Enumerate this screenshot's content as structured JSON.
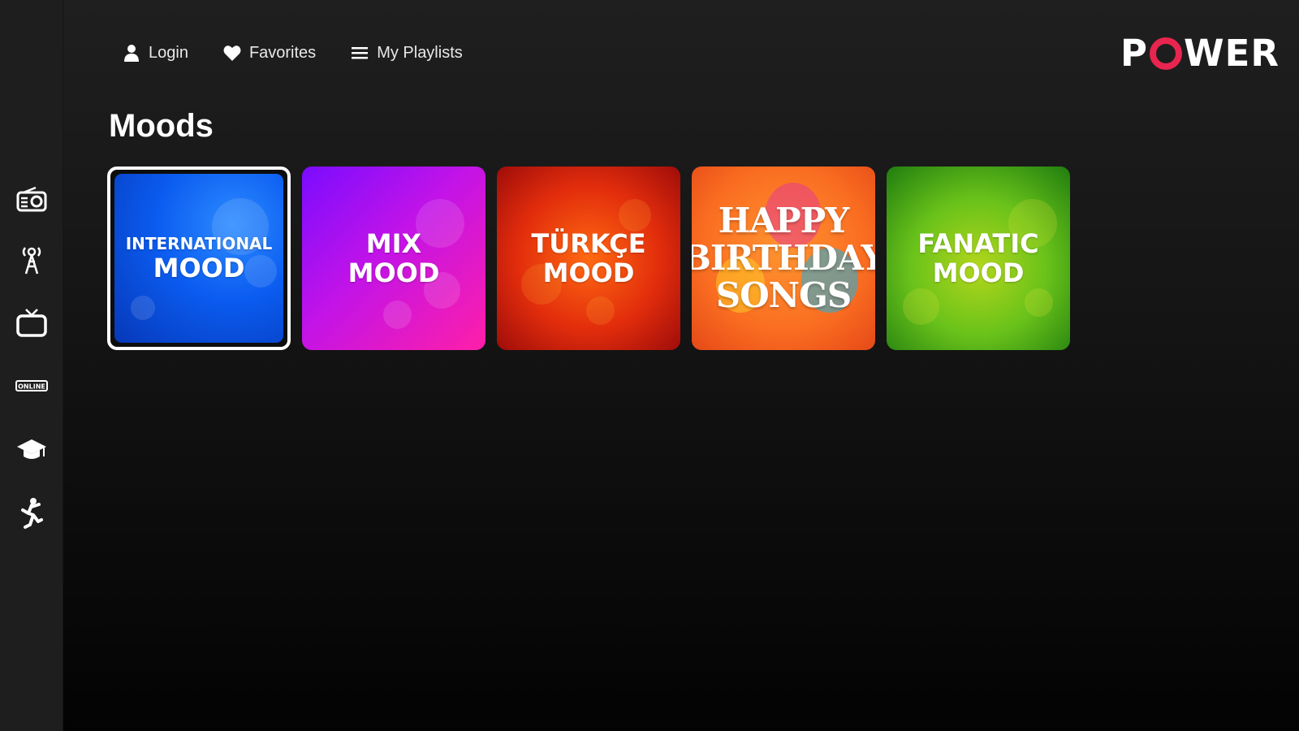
{
  "app": {
    "brand": "P",
    "brand_rest": "WER"
  },
  "nav": {
    "items": [
      {
        "label": "Login",
        "icon": "user-icon"
      },
      {
        "label": "Favorites",
        "icon": "heart-icon"
      },
      {
        "label": "My Playlists",
        "icon": "list-icon"
      }
    ]
  },
  "sidebar": {
    "items": [
      {
        "icon": "radio-icon"
      },
      {
        "icon": "broadcast-tower-icon"
      },
      {
        "icon": "tv-icon"
      },
      {
        "icon": "online-badge-icon",
        "text": "ONLINE"
      },
      {
        "icon": "graduation-cap-icon"
      },
      {
        "icon": "dancer-icon"
      }
    ]
  },
  "section": {
    "title": "Moods"
  },
  "tiles": [
    {
      "line1": "INTERNATIONAL",
      "line2": "MOOD",
      "color": "#0b5cf0",
      "selected": true
    },
    {
      "line1": "MIX",
      "line2": "MOOD",
      "color": "#c213e8"
    },
    {
      "line1": "TÜRKÇE",
      "line2": "MOOD",
      "color": "#e22d0c"
    },
    {
      "line1": "HAPPY",
      "line2": "BIRTHDAY",
      "line3": "SONGS",
      "color": "#fa6d21"
    },
    {
      "line1": "FANATIC",
      "line2": "MOOD",
      "color": "#69c21a"
    }
  ],
  "colors": {
    "accent": "#e8254f",
    "background": "#141414",
    "sidebar": "#1e1e1e"
  }
}
